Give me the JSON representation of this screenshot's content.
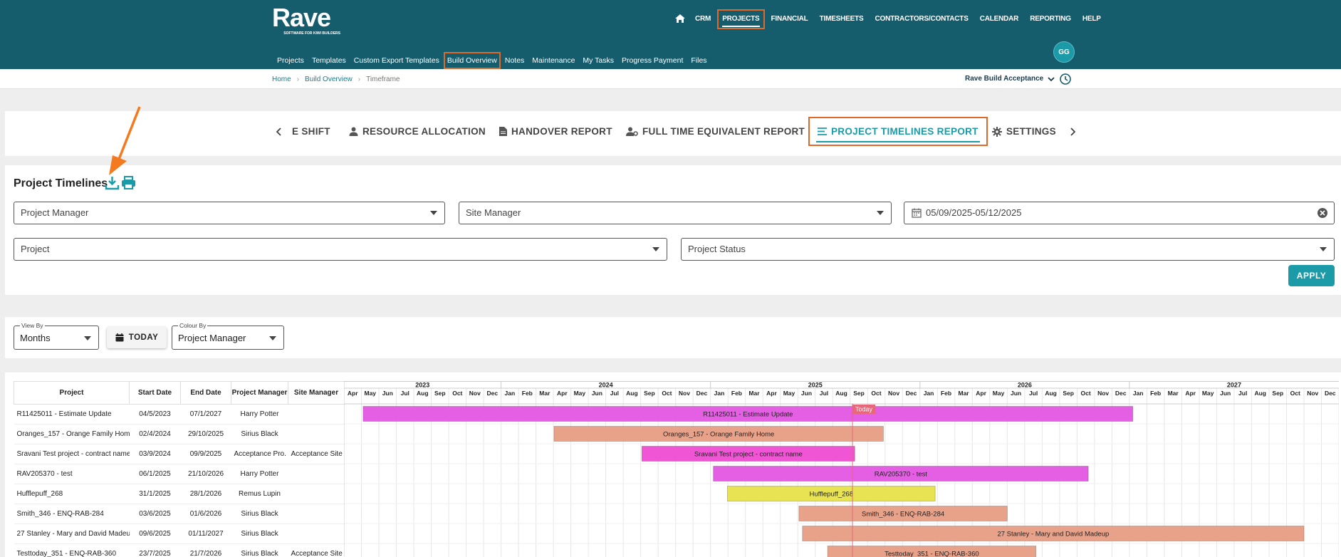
{
  "header": {
    "logo_name": "Rave",
    "logo_tagline": "SOFTWARE FOR KIWI BUILDERS",
    "main_nav": [
      "CRM",
      "PROJECTS",
      "FINANCIAL",
      "TIMESHEETS",
      "CONTRACTORS/CONTACTS",
      "CALENDAR",
      "REPORTING",
      "HELP"
    ],
    "active_main": "PROJECTS",
    "avatar": "GG",
    "sub_nav": [
      "Projects",
      "Templates",
      "Custom Export Templates",
      "Build Overview",
      "Notes",
      "Maintenance",
      "My Tasks",
      "Progress Payment",
      "Files"
    ],
    "active_sub": "Build Overview",
    "brand_color": "#155c6c",
    "accent_color": "#1b9aa8",
    "highlight_color": "#e0682b"
  },
  "breadcrumb": [
    "Home",
    "Build Overview",
    "Timeframe"
  ],
  "company": "Rave Build Acceptance",
  "report_tabs": [
    {
      "label": "E SHIFT",
      "icon": "none"
    },
    {
      "label": "RESOURCE ALLOCATION",
      "icon": "person-icon"
    },
    {
      "label": "HANDOVER REPORT",
      "icon": "document-icon"
    },
    {
      "label": "FULL TIME EQUIVALENT REPORT",
      "icon": "person-gear-icon"
    },
    {
      "label": "PROJECT TIMELINES REPORT",
      "icon": "list-icon",
      "active": true
    },
    {
      "label": "SETTINGS",
      "icon": "gear-icon"
    }
  ],
  "filters": {
    "title": "Project Timelines",
    "project_manager_placeholder": "Project Manager",
    "site_manager_placeholder": "Site Manager",
    "date_range": "05/09/2025-05/12/2025",
    "project_placeholder": "Project",
    "project_status_placeholder": "Project Status",
    "apply_label": "APPLY"
  },
  "view": {
    "view_by_label": "View By",
    "view_by_value": "Months",
    "today_label": "TODAY",
    "colour_by_label": "Colour By",
    "colour_by_value": "Project Manager"
  },
  "table": {
    "columns": [
      "Project",
      "Start Date",
      "End Date",
      "Project Manager",
      "Site Manager"
    ],
    "rows": [
      [
        "R11425011 - Estimate Update",
        "04/5/2023",
        "07/1/2027",
        "Harry Potter",
        ""
      ],
      [
        "Oranges_157 - Orange Family Home",
        "02/4/2024",
        "29/10/2025",
        "Sirius Black",
        ""
      ],
      [
        "Sravani Test project - contract name",
        "03/9/2024",
        "09/9/2025",
        "Acceptance Pro.",
        "Acceptance Site"
      ],
      [
        "RAV205370 - test",
        "06/1/2025",
        "21/10/2026",
        "Harry Potter",
        ""
      ],
      [
        "Hufflepuff_268",
        "31/1/2025",
        "28/1/2026",
        "Remus Lupin",
        ""
      ],
      [
        "Smith_346 - ENQ-RAB-284",
        "03/6/2025",
        "01/6/2026",
        "Sirius Black",
        ""
      ],
      [
        "27 Stanley - Mary and David Madeup",
        "09/6/2025",
        "01/11/2027",
        "Sirius Black",
        ""
      ],
      [
        "Testtoday_351 - ENQ-RAB-360",
        "23/7/2025",
        "21/7/2026",
        "Sirius Black",
        "Acceptance Site"
      ]
    ]
  },
  "chart_data": {
    "type": "gantt",
    "years": [
      "2023",
      "2024",
      "2025",
      "2026",
      "2027"
    ],
    "months": [
      "Jan",
      "Feb",
      "Mar",
      "Apr",
      "May",
      "Jun",
      "Jul",
      "Aug",
      "Sep",
      "Oct",
      "Nov",
      "Dec"
    ],
    "visible_start": "2023-04",
    "visible_end": "2027-12",
    "today_label": "Today",
    "today": "2025-09-05",
    "bars": [
      {
        "label": "R11425011 - Estimate Update",
        "start": "2023-05-04",
        "end": "2027-01-07",
        "color": "#e45fe3"
      },
      {
        "label": "Oranges_157 - Orange Family Home",
        "start": "2024-04-02",
        "end": "2025-10-29",
        "color": "#e9a28a"
      },
      {
        "label": "Sravani Test project - contract name",
        "start": "2024-09-03",
        "end": "2025-09-09",
        "color": "#ef55d4"
      },
      {
        "label": "RAV205370 - test",
        "start": "2025-01-06",
        "end": "2026-10-21",
        "color": "#e45fe3"
      },
      {
        "label": "Hufflepuff_268",
        "start": "2025-01-31",
        "end": "2026-01-28",
        "color": "#e7e352"
      },
      {
        "label": "Smith_346 - ENQ-RAB-284",
        "start": "2025-06-03",
        "end": "2026-06-01",
        "color": "#e9a28a"
      },
      {
        "label": "27 Stanley - Mary and David Madeup",
        "start": "2025-06-09",
        "end": "2027-11-01",
        "color": "#e9a28a"
      },
      {
        "label": "Testtoday_351 - ENQ-RAB-360",
        "start": "2025-07-23",
        "end": "2026-07-21",
        "color": "#e9a28a"
      }
    ]
  }
}
